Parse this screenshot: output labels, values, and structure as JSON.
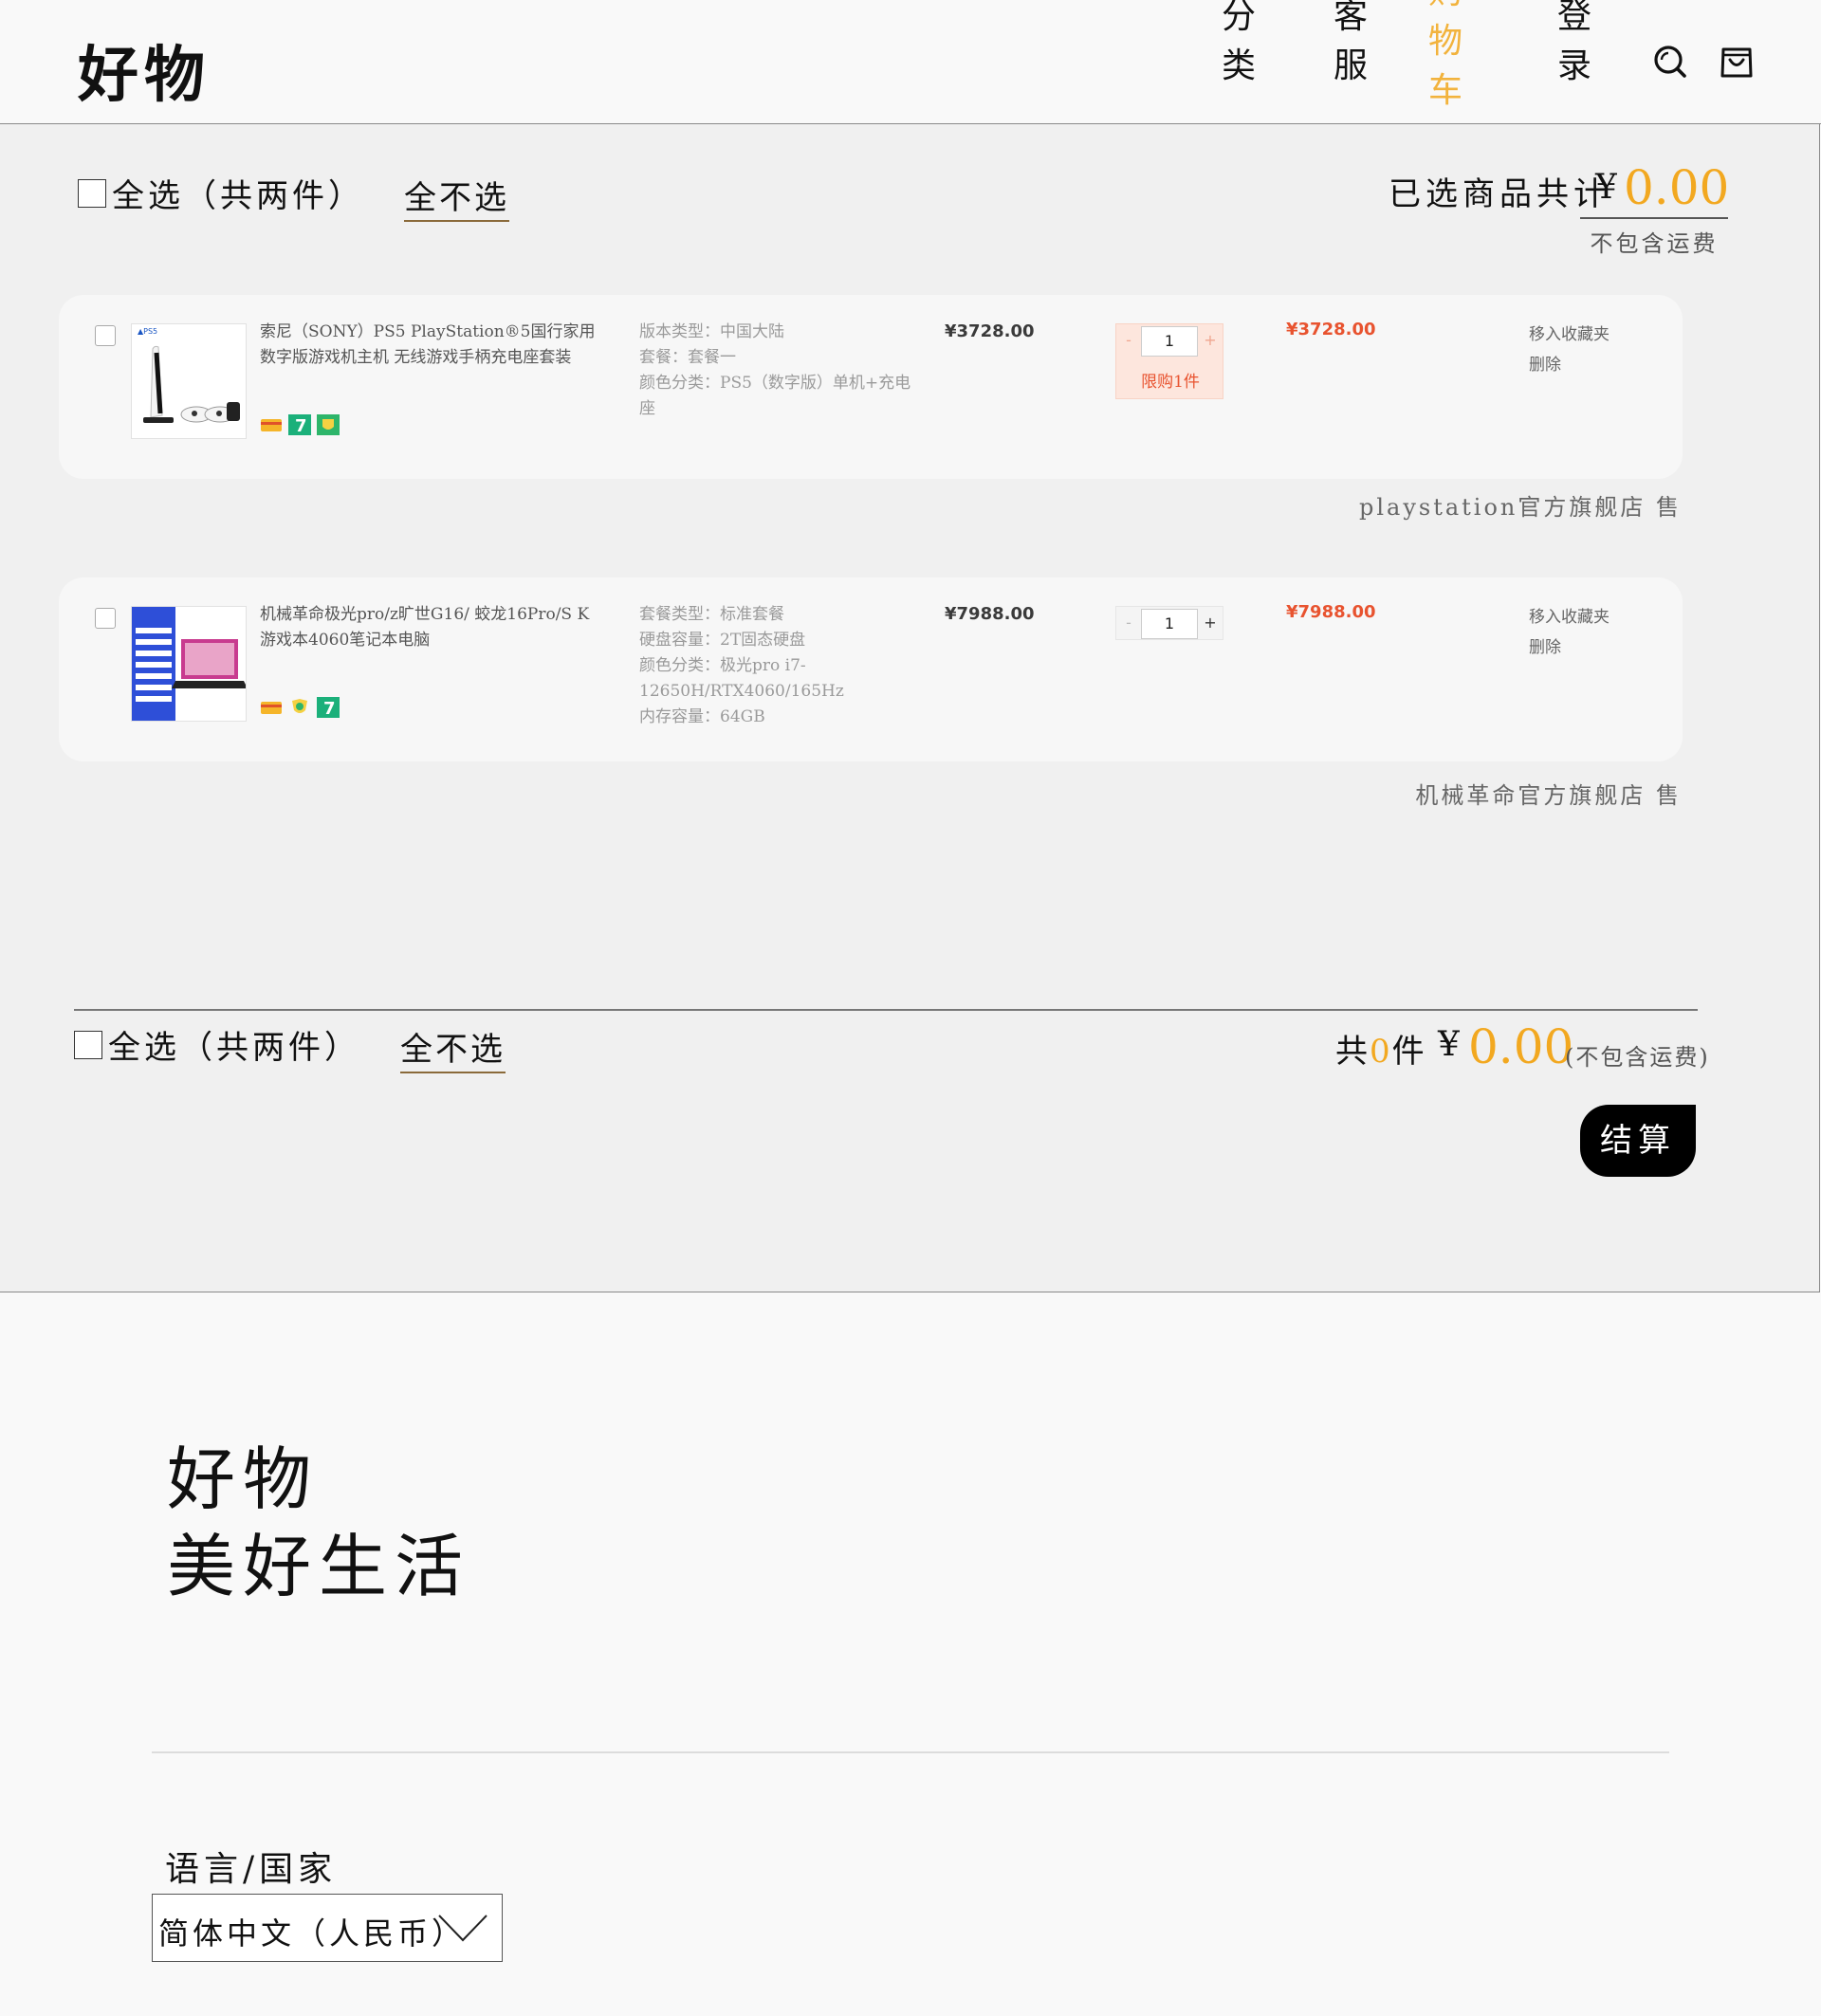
{
  "header": {
    "logo": "好物",
    "nav": [
      "分类",
      "客服",
      "购物车",
      "登录"
    ]
  },
  "cart_top": {
    "select_all": "全选（共两件）",
    "select_none": "全不选",
    "selected_total_label": "已选商品共计",
    "currency": "¥",
    "total": "0.00",
    "shipping_note": "不包含运费"
  },
  "items": [
    {
      "name": "索尼（SONY）PS5 PlayStation®5国行家用数字版游戏机主机 无线游戏手柄充电座套装",
      "specs": [
        "版本类型：中国大陆",
        "套餐：套餐一",
        "颜色分类：PS5（数字版）单机+充电座"
      ],
      "unit_price": "¥3728.00",
      "quantity": "1",
      "limit": "限购1件",
      "subtotal": "¥3728.00",
      "op_favorite": "移入收藏夹",
      "op_delete": "删除",
      "shop": "playstation官方旗舰店 售"
    },
    {
      "name": "机械革命极光pro/z旷世G16/ 蛟龙16Pro/S K 游戏本4060笔记本电脑",
      "specs": [
        "套餐类型：标准套餐",
        "硬盘容量：2T固态硬盘",
        "颜色分类：极光pro i7-12650H/RTX4060/165Hz",
        "内存容量：64GB"
      ],
      "unit_price": "¥7988.00",
      "quantity": "1",
      "subtotal": "¥7988.00",
      "op_favorite": "移入收藏夹",
      "op_delete": "删除",
      "shop": "机械革命官方旗舰店 售"
    }
  ],
  "cart_bottom": {
    "select_all": "全选（共两件）",
    "select_none": "全不选",
    "count_prefix": "共",
    "count": "0",
    "count_suffix": "件",
    "currency": "¥",
    "total": "0.00",
    "shipping_note": "(不包含运费)",
    "checkout": "结算"
  },
  "footer": {
    "logo_line1": "好物",
    "logo_line2": "美好生活",
    "lang_label": "语言/国家",
    "lang_value": "简体中文（人民币）"
  },
  "colors": {
    "accent": "#f2b33d",
    "price_red": "#e8532f",
    "panel_bg": "#f0f0f0"
  }
}
